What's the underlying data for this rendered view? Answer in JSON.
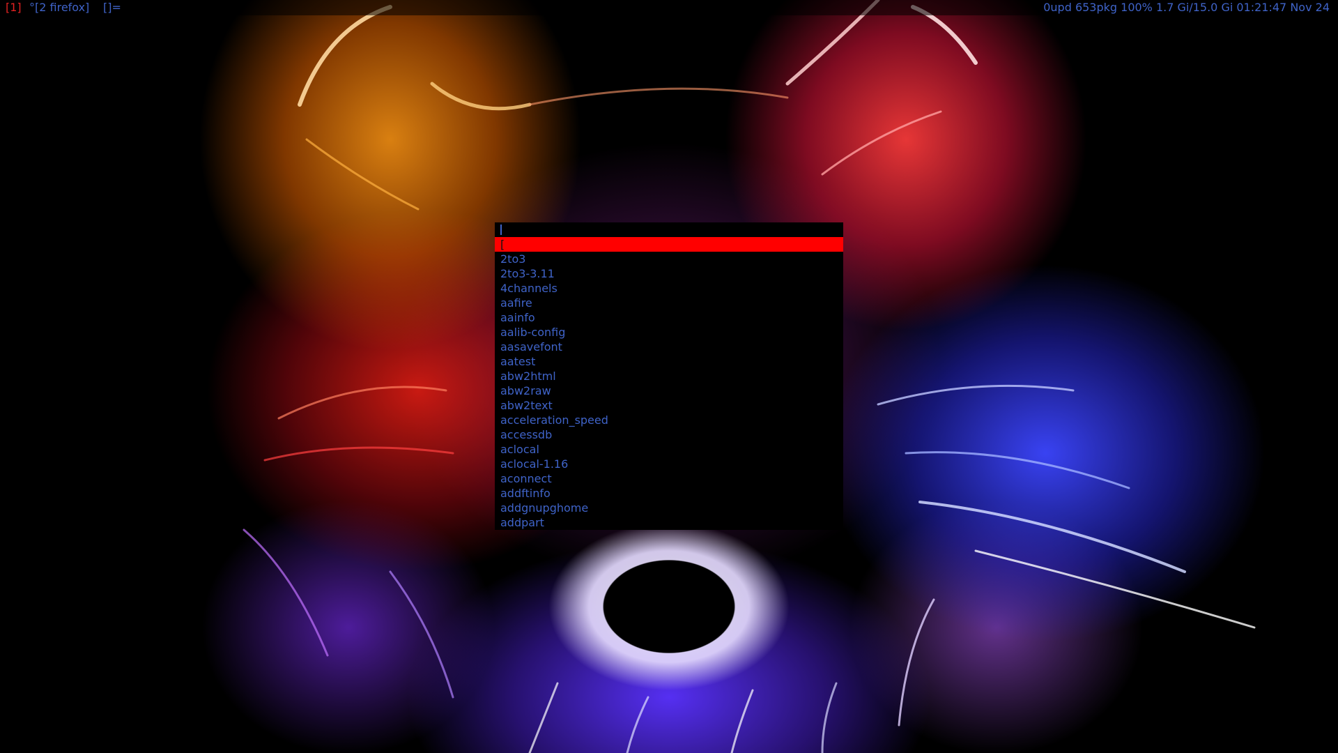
{
  "statusbar": {
    "active_tag": "[1]",
    "window_title": "°[2 firefox]",
    "layout_symbol": "[]=",
    "status_text": "0upd 653pkg 100% 1.7 Gi/15.0 Gi 01:21:47 Nov 24"
  },
  "launcher": {
    "input_value": "",
    "selected_index": 0,
    "items": [
      "[",
      "2to3",
      "2to3-3.11",
      "4channels",
      "aafire",
      "aainfo",
      "aalib-config",
      "aasavefont",
      "aatest",
      "abw2html",
      "abw2raw",
      "abw2text",
      "acceleration_speed",
      "accessdb",
      "aclocal",
      "aclocal-1.16",
      "aconnect",
      "addftinfo",
      "addgnupghome",
      "addpart"
    ]
  },
  "colors": {
    "bar_text": "#3f63c8",
    "active_tag": "#e22222",
    "selection_bg": "#ff0000",
    "launcher_bg": "#000000",
    "item_text": "#3f63c8"
  }
}
